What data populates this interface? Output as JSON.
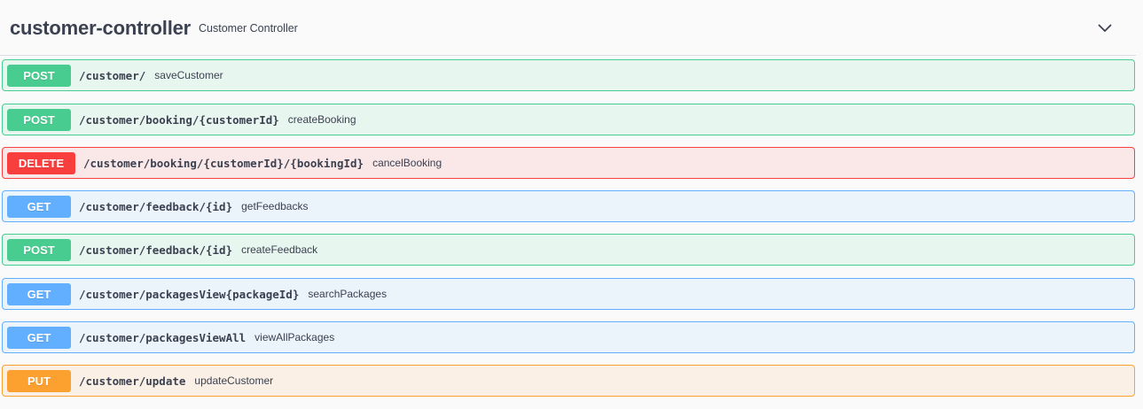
{
  "section": {
    "title": "customer-controller",
    "description": "Customer Controller",
    "toggle_icon": "chevron-down-icon"
  },
  "colors": {
    "post": "#49cc90",
    "delete": "#f93e3e",
    "get": "#61affe",
    "put": "#fca130"
  },
  "operations": [
    {
      "method": "POST",
      "path": "/customer/",
      "summary": "saveCustomer"
    },
    {
      "method": "POST",
      "path": "/customer/booking/{customerId}",
      "summary": "createBooking"
    },
    {
      "method": "DELETE",
      "path": "/customer/booking/{customerId}/{bookingId}",
      "summary": "cancelBooking"
    },
    {
      "method": "GET",
      "path": "/customer/feedback/{id}",
      "summary": "getFeedbacks"
    },
    {
      "method": "POST",
      "path": "/customer/feedback/{id}",
      "summary": "createFeedback"
    },
    {
      "method": "GET",
      "path": "/customer/packagesView{packageId}",
      "summary": "searchPackages"
    },
    {
      "method": "GET",
      "path": "/customer/packagesViewAll",
      "summary": "viewAllPackages"
    },
    {
      "method": "PUT",
      "path": "/customer/update",
      "summary": "updateCustomer"
    }
  ]
}
